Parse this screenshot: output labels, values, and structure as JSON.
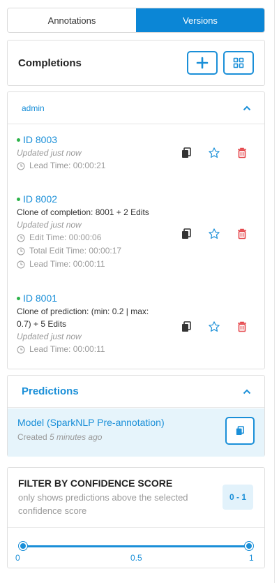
{
  "tabs": {
    "annotations": "Annotations",
    "versions": "Versions",
    "active": "versions"
  },
  "completions": {
    "title": "Completions",
    "add_icon": "plus-icon",
    "view_icon": "grid-icon"
  },
  "group": {
    "user": "admin",
    "entries": [
      {
        "id": "ID 8003",
        "clone": "",
        "updated": "Updated just now",
        "meta": [
          "Lead Time: 00:00:21"
        ]
      },
      {
        "id": "ID 8002",
        "clone": "Clone of completion: 8001 + 2 Edits",
        "updated": "Updated just now",
        "meta": [
          "Edit Time: 00:00:06",
          "Total Edit Time: 00:00:17",
          "Lead Time: 00:00:11"
        ]
      },
      {
        "id": "ID 8001",
        "clone_line1": "Clone of prediction: (min: 0.2 | max:",
        "clone_line2": "0.7) + 5 Edits",
        "updated": "Updated just now",
        "meta": [
          "Lead Time: 00:00:11"
        ]
      }
    ]
  },
  "predictions": {
    "title": "Predictions",
    "model": "Model (SparkNLP Pre-annotation)",
    "created_prefix": "Created",
    "created_when": "5 minutes ago"
  },
  "filter": {
    "title": "FILTER BY CONFIDENCE SCORE",
    "subtitle": "only shows predictions above the selected confidence score",
    "range_label": "0 - 1",
    "min": 0,
    "max": 1,
    "low": 0,
    "high": 1,
    "ticks": [
      "0",
      "0.5",
      "1"
    ]
  },
  "colors": {
    "accent": "#1a8fd8",
    "active_tab": "#0b86d6",
    "delete": "#e5484d",
    "status": "#2db34a"
  }
}
